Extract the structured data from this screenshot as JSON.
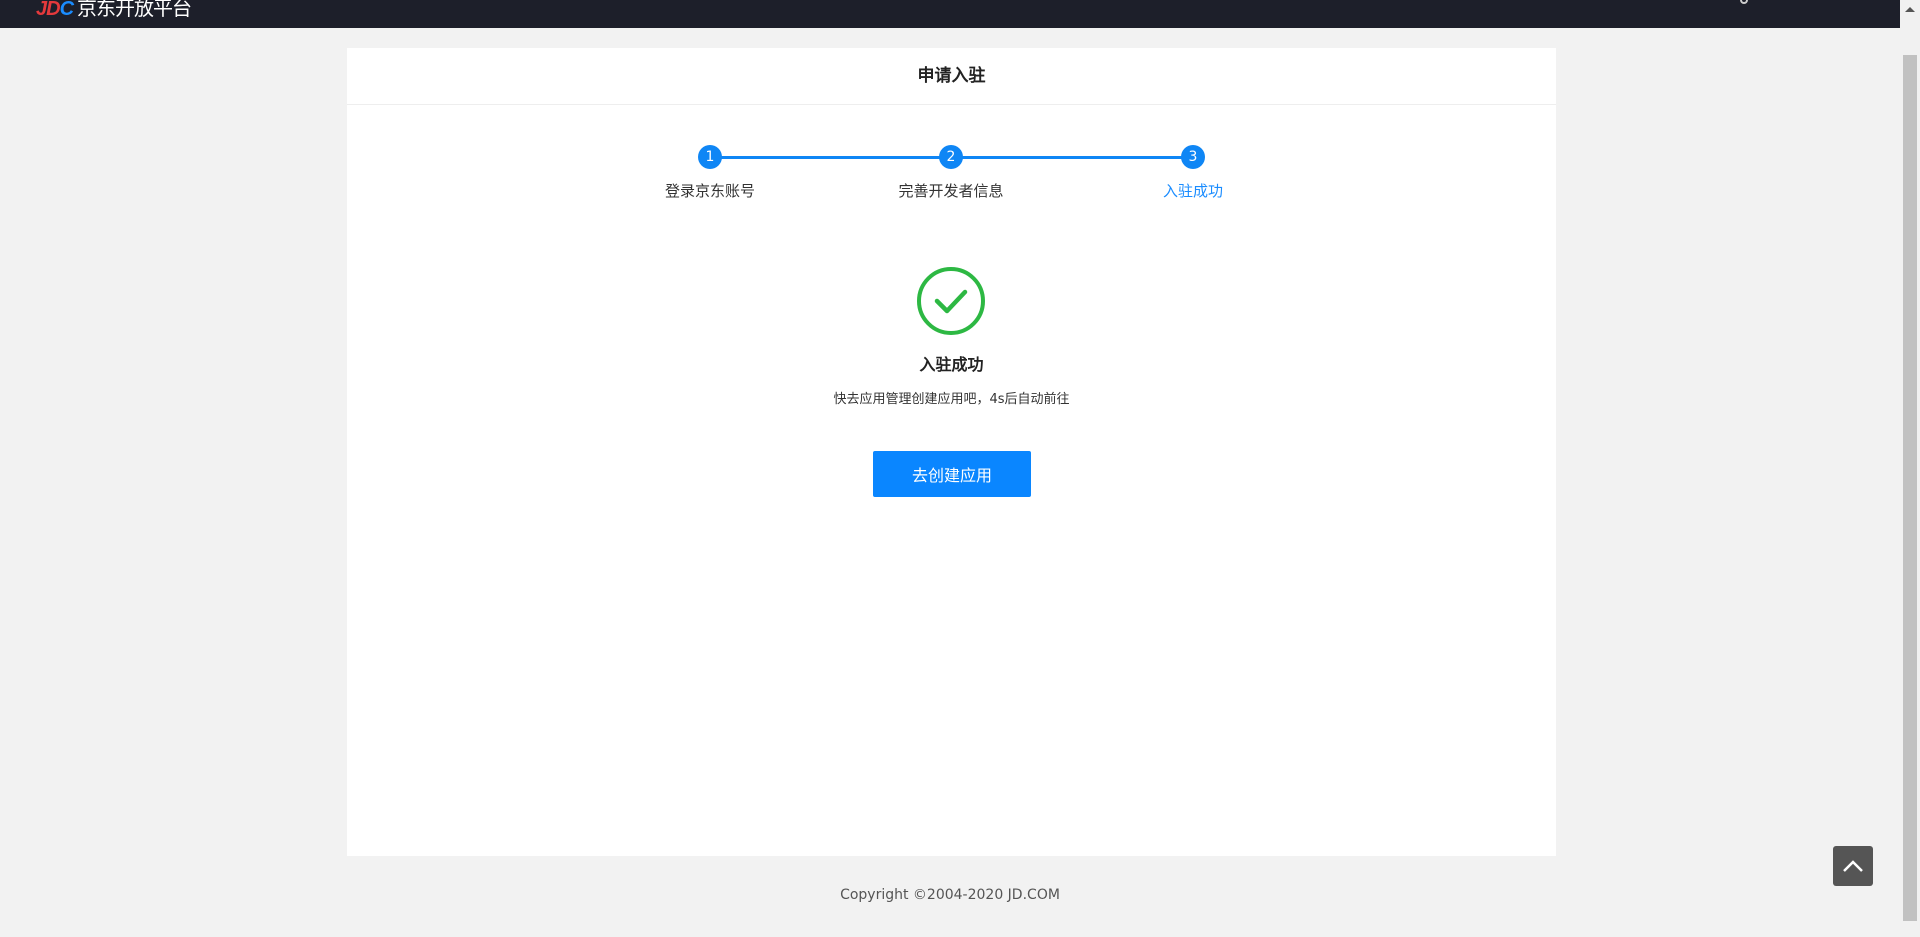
{
  "header": {
    "logo_text": "JDC 京东开放平台"
  },
  "card": {
    "title": "申请入驻"
  },
  "steps": [
    {
      "num": "1",
      "label": "登录京东账号"
    },
    {
      "num": "2",
      "label": "完善开发者信息"
    },
    {
      "num": "3",
      "label": "入驻成功"
    }
  ],
  "result": {
    "title": "入驻成功",
    "message": "快去应用管理创建应用吧，4s后自动前往",
    "button": "去创建应用"
  },
  "footer": {
    "copyright": "Copyright ©2004-2020 JD.COM"
  },
  "colors": {
    "accent": "#0f86f5",
    "success": "#2db843",
    "header": "#1d1f2a"
  }
}
